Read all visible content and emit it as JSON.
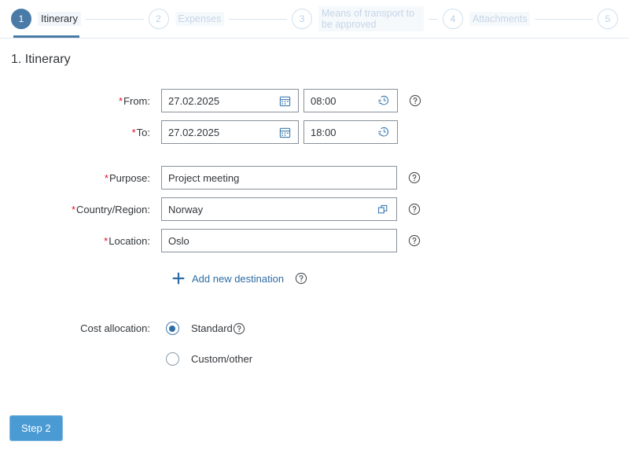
{
  "wizard": {
    "steps": [
      {
        "number": "1",
        "label": "Itinerary",
        "state": "active"
      },
      {
        "number": "2",
        "label": "Expenses",
        "state": "inactive"
      },
      {
        "number": "3",
        "label": "Means of transport to be approved",
        "state": "inactive"
      },
      {
        "number": "4",
        "label": "Attachments",
        "state": "inactive"
      },
      {
        "number": "5",
        "label": "",
        "state": "inactive"
      }
    ],
    "accent_color": "#4a7ba7",
    "inactive_color": "#c5d6e6"
  },
  "page": {
    "title": "1. Itinerary"
  },
  "form": {
    "from": {
      "label": "From:",
      "required": true,
      "date_value": "27.02.2025",
      "time_value": "08:00",
      "date_icon": "calendar-icon",
      "time_icon": "clock-icon",
      "help_icon": "help-icon"
    },
    "to": {
      "label": "To:",
      "required": true,
      "date_value": "27.02.2025",
      "time_value": "18:00",
      "date_icon": "calendar-icon",
      "time_icon": "clock-icon"
    },
    "purpose": {
      "label": "Purpose:",
      "required": true,
      "value": "Project meeting",
      "help_icon": "help-icon"
    },
    "country": {
      "label": "Country/Region:",
      "required": true,
      "value": "Norway",
      "value_help_icon": "value-help-icon",
      "help_icon": "help-icon"
    },
    "location": {
      "label": "Location:",
      "required": true,
      "value": "Oslo",
      "help_icon": "help-icon"
    },
    "add_destination": {
      "label": "Add new destination",
      "plus_icon": "plus-icon",
      "help_icon": "help-icon",
      "link_color": "#2e6ca4"
    },
    "cost_allocation": {
      "label": "Cost allocation:",
      "help_icon": "help-icon",
      "options": [
        {
          "label": "Standard",
          "selected": true
        },
        {
          "label": "Custom/other",
          "selected": false
        }
      ]
    }
  },
  "footer": {
    "next_button": "Step 2",
    "button_color": "#4a9ad4"
  }
}
